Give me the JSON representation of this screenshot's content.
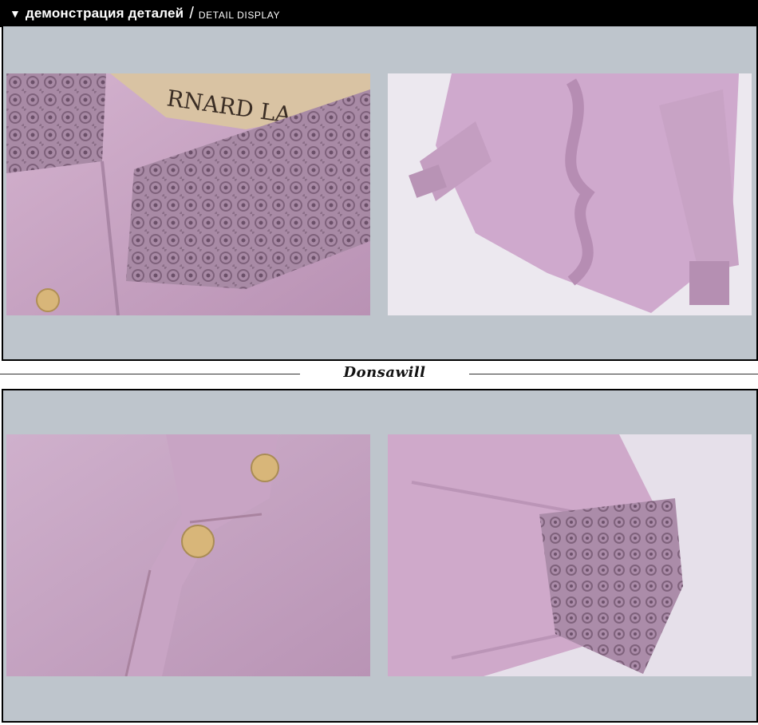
{
  "header": {
    "arrow_icon": "triangle-down-icon",
    "title_ru": "демонстрация деталей",
    "separator": "/",
    "title_en": "DETAIL DISPLAY"
  },
  "brand": {
    "name": "Donsawill"
  },
  "photos": [
    {
      "subject": "lace-collar",
      "hanger_text": "RNARD LA"
    },
    {
      "subject": "blouse-ruffle-front"
    },
    {
      "subject": "metal-buttons-placket"
    },
    {
      "subject": "lace-cuff-sleeve"
    }
  ],
  "colors": {
    "header_bg": "#000000",
    "panel_bg": "#bec5cc",
    "fabric": "#c9a6c5",
    "lace": "#a27e9f",
    "button_gold": "#d8b679"
  }
}
